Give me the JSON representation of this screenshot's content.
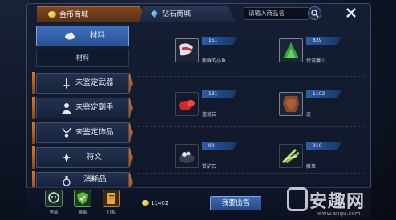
{
  "header": {
    "tabs": [
      {
        "label": "金币商城",
        "active": true,
        "icon": "gold-coin-icon"
      },
      {
        "label": "钻石商城",
        "active": false,
        "icon": "diamond-icon"
      }
    ],
    "search": {
      "placeholder": "请输入商品名",
      "icon": "search-icon"
    },
    "close_icon": "close-icon"
  },
  "sidebar": {
    "categories": [
      {
        "label": "材料",
        "active": true,
        "icon": "cloud-icon"
      },
      {
        "label": "未鉴定武器",
        "active": false,
        "icon": "sword-icon"
      },
      {
        "label": "未鉴定副手",
        "active": false,
        "icon": "person-icon"
      },
      {
        "label": "未鉴定饰品",
        "active": false,
        "icon": "necklace-icon"
      },
      {
        "label": "符文",
        "active": false,
        "icon": "rune-icon"
      },
      {
        "label": "消耗品",
        "active": false,
        "icon": "potion-icon"
      }
    ],
    "subheading": "材料"
  },
  "items": [
    {
      "name": "新鲜的小鱼",
      "price": "151",
      "icon": "fish-icon"
    },
    {
      "name": "传说魔山",
      "price": "839",
      "icon": "green-mountain-icon"
    },
    {
      "name": "蓝斑岩",
      "price": "131",
      "icon": "red-ore-icon"
    },
    {
      "name": "皮",
      "price": "1102",
      "icon": "leather-icon"
    },
    {
      "name": "铁矿石",
      "price": "90",
      "icon": "iron-ore-icon"
    },
    {
      "name": "藤草",
      "price": "910",
      "icon": "herb-icon"
    }
  ],
  "bottom": {
    "buttons": [
      {
        "label": "等级",
        "icon": "face-icon"
      },
      {
        "label": "装备",
        "icon": "shield-icon"
      },
      {
        "label": "打稿",
        "icon": "scroll-icon"
      }
    ],
    "gold": "11402",
    "sell_label": "我要出售"
  },
  "watermark": {
    "text": "安趣网",
    "url": "www.anqu.com"
  },
  "colors": {
    "accent": "#3f6fb9",
    "tab_active": "#7a4722",
    "price_tag": "#2c5ea9"
  }
}
